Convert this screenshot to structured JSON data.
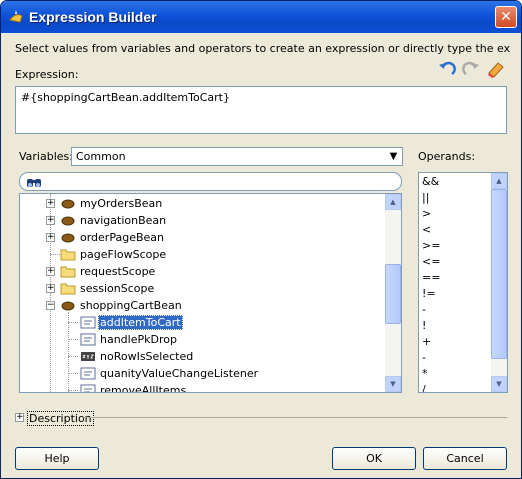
{
  "window": {
    "title": "Expression Builder",
    "close_glyph": "✕"
  },
  "instruction": "Select values from variables and operators to create an expression or directly type the expression h...",
  "expression": {
    "label": "Expression:",
    "value": "#{shoppingCartBean.addItemToCart}"
  },
  "variables": {
    "label": "Variables:",
    "selected": "Common",
    "search_value": ""
  },
  "operands": {
    "label": "Operands:",
    "items": [
      "&&",
      "||",
      ">",
      "<",
      ">=",
      "<=",
      "==",
      "!=",
      "-",
      "!",
      "+",
      "-",
      "*",
      "/"
    ]
  },
  "tree": {
    "items": [
      {
        "label": "myOrdersBean",
        "icon": "bean-icon",
        "expander": "+"
      },
      {
        "label": "navigationBean",
        "icon": "bean-icon",
        "expander": "+"
      },
      {
        "label": "orderPageBean",
        "icon": "bean-icon",
        "expander": "+"
      },
      {
        "label": "pageFlowScope",
        "icon": "folder-icon",
        "expander": ""
      },
      {
        "label": "requestScope",
        "icon": "folder-icon",
        "expander": "+"
      },
      {
        "label": "sessionScope",
        "icon": "folder-icon",
        "expander": "+"
      },
      {
        "label": "shoppingCartBean",
        "icon": "bean-icon",
        "expander": "−"
      },
      {
        "label": "addItemToCart",
        "icon": "method-icon",
        "expander": ""
      },
      {
        "label": "handlePkDrop",
        "icon": "method-icon",
        "expander": ""
      },
      {
        "label": "noRowIsSelected",
        "icon": "property-icon",
        "expander": ""
      },
      {
        "label": "quanityValueChangeListener",
        "icon": "method-icon",
        "expander": ""
      },
      {
        "label": "removeAllItems",
        "icon": "method-icon",
        "expander": ""
      }
    ],
    "selected_index": 7
  },
  "description": {
    "label": "Description",
    "expander": "+"
  },
  "buttons": {
    "help": "Help",
    "ok": "OK",
    "cancel": "Cancel"
  }
}
